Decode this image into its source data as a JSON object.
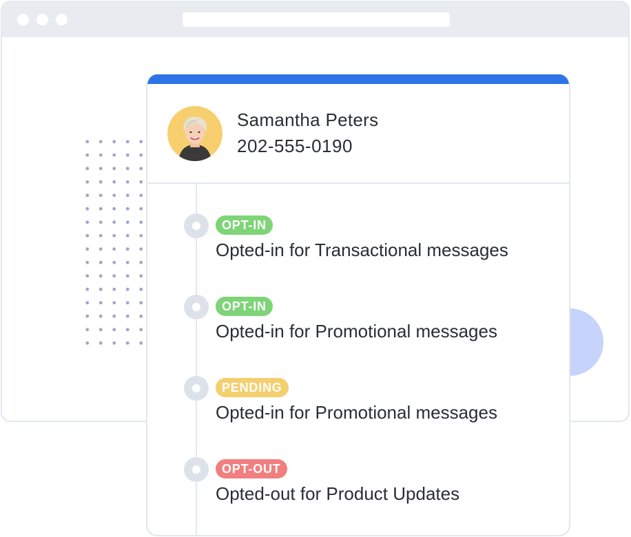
{
  "contact": {
    "name": "Samantha Peters",
    "phone": "202-555-0190"
  },
  "events": [
    {
      "status": "OPT-IN",
      "color": "#7ed477",
      "text": "Opted-in for Transactional messages"
    },
    {
      "status": "OPT-IN",
      "color": "#7ed477",
      "text": "Opted-in for Promotional messages"
    },
    {
      "status": "PENDING",
      "color": "#f4cf6f",
      "text": "Opted-in for Promotional messages"
    },
    {
      "status": "OPT-OUT",
      "color": "#f27f7f",
      "text": "Opted-out for Product Updates"
    }
  ],
  "colors": {
    "accent": "#2e74e8",
    "avatar_bg": "#f7cf6f",
    "blob": "#c6d3fb",
    "border": "#e3e7ee"
  },
  "icons": {
    "avatar": "user-photo",
    "marker": "timeline-dot-icon"
  }
}
